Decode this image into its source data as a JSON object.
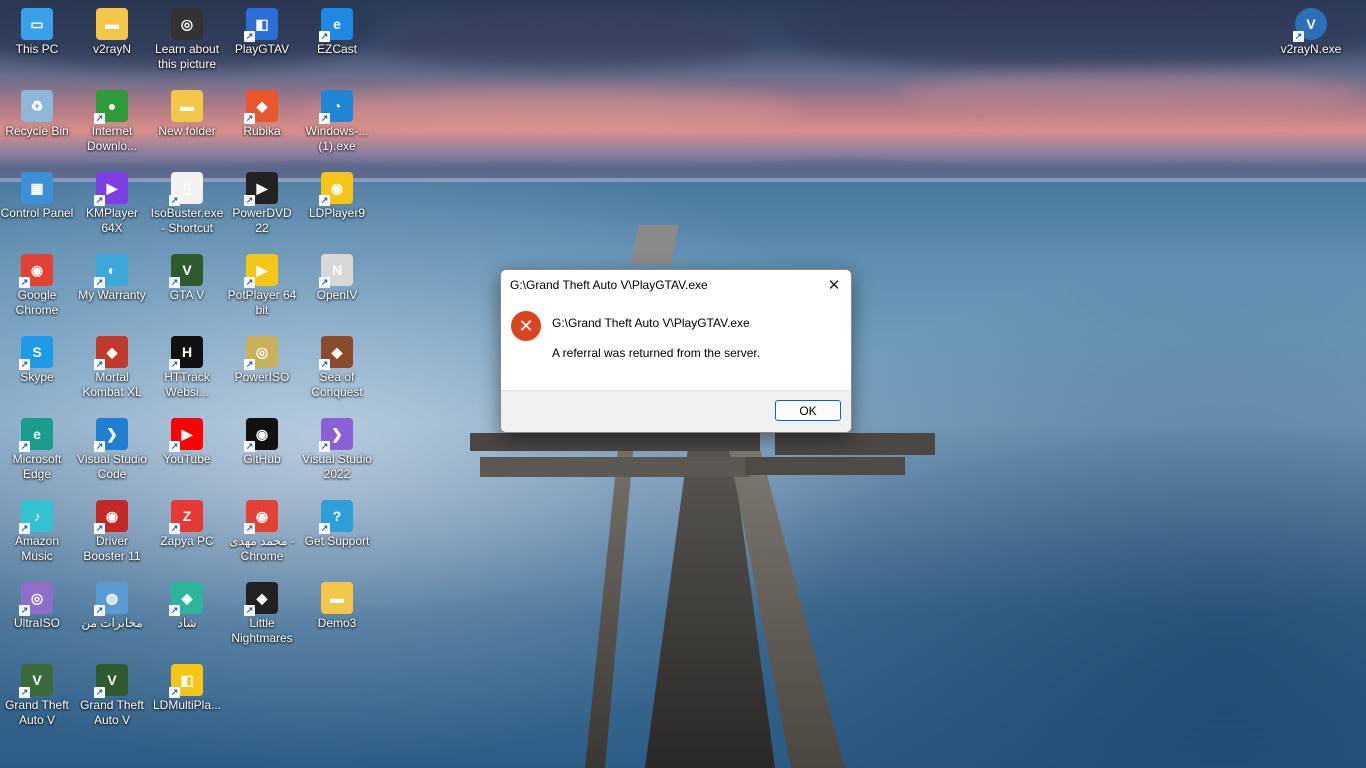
{
  "desktop": {
    "icons": [
      {
        "label": "This PC",
        "color": "#3aa0e8",
        "glyph": "▭",
        "shortcut": false
      },
      {
        "label": "v2rayN",
        "color": "#f3c74a",
        "glyph": "▬",
        "shortcut": false
      },
      {
        "label": "Learn about this picture",
        "color": "#333333",
        "glyph": "◎",
        "shortcut": false
      },
      {
        "label": "PlayGTAV",
        "color": "#2b6fd6",
        "glyph": "◧",
        "shortcut": true
      },
      {
        "label": "EZCast",
        "color": "#1e88e5",
        "glyph": "e",
        "shortcut": true
      },
      {
        "label": "Recycle Bin",
        "color": "#8fb8d8",
        "glyph": "♻",
        "shortcut": false
      },
      {
        "label": "Internet Downlo...",
        "color": "#2f9b3a",
        "glyph": "●",
        "shortcut": true
      },
      {
        "label": "New folder",
        "color": "#f3c74a",
        "glyph": "▬",
        "shortcut": false
      },
      {
        "label": "Rubika",
        "color": "#e8562c",
        "glyph": "◆",
        "shortcut": true
      },
      {
        "label": "Windows-... (1).exe",
        "color": "#1f86d6",
        "glyph": "◔",
        "shortcut": true
      },
      {
        "label": "Control Panel",
        "color": "#3d8fd6",
        "glyph": "▦",
        "shortcut": false
      },
      {
        "label": "KMPlayer 64X",
        "color": "#7b3fe4",
        "glyph": "▶",
        "shortcut": true
      },
      {
        "label": "IsoBuster.exe - Shortcut",
        "color": "#f2f2f2",
        "glyph": "▯",
        "shortcut": true
      },
      {
        "label": "PowerDVD 22",
        "color": "#222222",
        "glyph": "▶",
        "shortcut": true
      },
      {
        "label": "LDPlayer9",
        "color": "#f5c518",
        "glyph": "◉",
        "shortcut": true
      },
      {
        "label": "Google Chrome",
        "color": "#e34133",
        "glyph": "◉",
        "shortcut": true
      },
      {
        "label": "My Warranty",
        "color": "#3aa9d9",
        "glyph": "◐",
        "shortcut": true
      },
      {
        "label": "GTA V",
        "color": "#2e5a2e",
        "glyph": "V",
        "shortcut": true
      },
      {
        "label": "PotPlayer 64 bit",
        "color": "#f5c518",
        "glyph": "▶",
        "shortcut": true
      },
      {
        "label": "OpenIV",
        "color": "#d8d8d8",
        "glyph": "N",
        "shortcut": true
      },
      {
        "label": "Skype",
        "color": "#1e9be8",
        "glyph": "S",
        "shortcut": true
      },
      {
        "label": "Mortal Kombat XL",
        "color": "#c0392b",
        "glyph": "◆",
        "shortcut": true
      },
      {
        "label": "HTTrack Websi...",
        "color": "#111111",
        "glyph": "H",
        "shortcut": true
      },
      {
        "label": "PowerISO",
        "color": "#c9b05a",
        "glyph": "◎",
        "shortcut": true
      },
      {
        "label": "Sea of Conquest",
        "color": "#8a4b2a",
        "glyph": "◆",
        "shortcut": true
      },
      {
        "label": "Microsoft Edge",
        "color": "#1a9c8c",
        "glyph": "e",
        "shortcut": true
      },
      {
        "label": "Visual Studio Code",
        "color": "#1f7fd0",
        "glyph": "❯",
        "shortcut": true
      },
      {
        "label": "YouTube",
        "color": "#ff0000",
        "glyph": "▶",
        "shortcut": true
      },
      {
        "label": "GitHub",
        "color": "#111111",
        "glyph": "◉",
        "shortcut": true
      },
      {
        "label": "Visual Studio 2022",
        "color": "#8b5fd6",
        "glyph": "❯",
        "shortcut": true
      },
      {
        "label": "Amazon Music",
        "color": "#35c2d0",
        "glyph": "♪",
        "shortcut": true
      },
      {
        "label": "Driver Booster 11",
        "color": "#c62828",
        "glyph": "◉",
        "shortcut": true
      },
      {
        "label": "Zapya PC",
        "color": "#e53935",
        "glyph": "Z",
        "shortcut": true
      },
      {
        "label": "محمد مهدی - Chrome",
        "color": "#e34133",
        "glyph": "◉",
        "shortcut": true
      },
      {
        "label": "Get Support",
        "color": "#2f9fd9",
        "glyph": "?",
        "shortcut": true
      },
      {
        "label": "UltraISO",
        "color": "#8e6fc8",
        "glyph": "◎",
        "shortcut": true
      },
      {
        "label": "مخابرات من",
        "color": "#5a9bd4",
        "glyph": "◍",
        "shortcut": true
      },
      {
        "label": "شاد",
        "color": "#2fb39a",
        "glyph": "◈",
        "shortcut": true
      },
      {
        "label": "Little Nightmares",
        "color": "#222222",
        "glyph": "◆",
        "shortcut": true
      },
      {
        "label": "Demo3",
        "color": "#f3c74a",
        "glyph": "▬",
        "shortcut": false
      },
      {
        "label": "Grand Theft Auto V",
        "color": "#3b6b3b",
        "glyph": "V",
        "shortcut": true
      },
      {
        "label": "Grand Theft Auto V",
        "color": "#2e5a2e",
        "glyph": "V",
        "shortcut": true
      },
      {
        "label": "LDMultiPla...",
        "color": "#f5c518",
        "glyph": "◧",
        "shortcut": true
      }
    ],
    "top_right_icon": {
      "label": "v2rayN.exe",
      "color": "#2a6fb8",
      "glyph": "V",
      "shortcut": true
    }
  },
  "dialog": {
    "title": "G:\\Grand Theft Auto V\\PlayGTAV.exe",
    "close_glyph": "✕",
    "error_glyph": "✕",
    "error_color": "#d9451f",
    "message_path": "G:\\Grand Theft Auto V\\PlayGTAV.exe",
    "message_text": "A referral was returned from the server.",
    "ok_label": "OK"
  }
}
